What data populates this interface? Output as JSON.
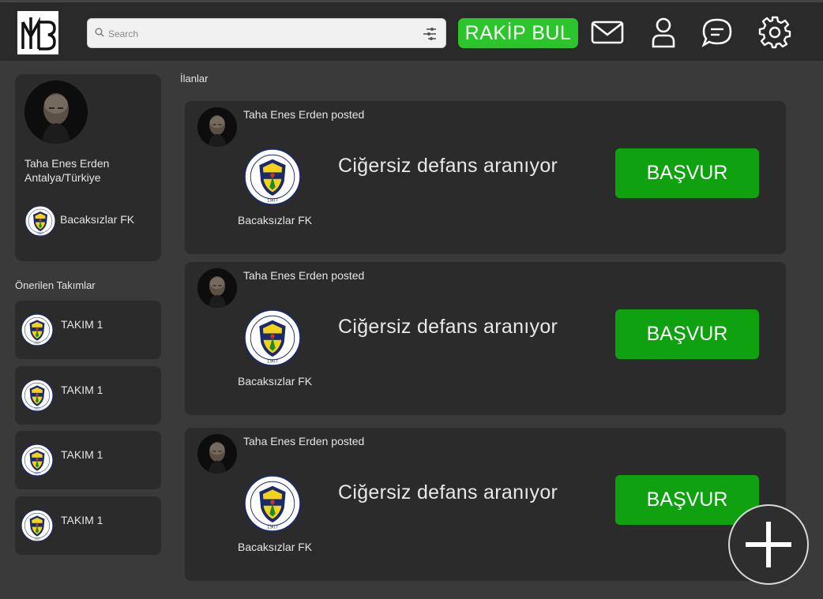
{
  "header": {
    "logo_text": "MTB",
    "search_placeholder": "Search",
    "find_opponent_label": "RAKİP BUL",
    "icons": [
      "mail-icon",
      "user-icon",
      "chat-icon",
      "gear-icon",
      "filter-icon",
      "search-icon"
    ]
  },
  "profile": {
    "name": "Taha Enes Erden",
    "location": "Antalya/Türkiye",
    "team": "Bacaksızlar FK"
  },
  "suggested": {
    "title": "Önerilen Takımlar",
    "teams": [
      {
        "name": "TAKIM 1"
      },
      {
        "name": "TAKIM 1"
      },
      {
        "name": "TAKIM 1"
      },
      {
        "name": "TAKIM 1"
      }
    ]
  },
  "feed": {
    "title": "İlanlar",
    "posts": [
      {
        "author_line": "Taha Enes Erden posted",
        "team": "Bacaksızlar FK",
        "text": "Ciğersiz defans aranıyor",
        "action": "BAŞVUR"
      },
      {
        "author_line": "Taha Enes Erden posted",
        "team": "Bacaksızlar FK",
        "text": "Ciğersiz defans aranıyor",
        "action": "BAŞVUR"
      },
      {
        "author_line": "Taha Enes Erden posted",
        "team": "Bacaksızlar FK",
        "text": "Ciğersiz defans aranıyor",
        "action": "BAŞVUR"
      }
    ]
  },
  "colors": {
    "background": "#3a3a3a",
    "topbar": "#2a2a2a",
    "card": "#2b2b2b",
    "find_button": "#2cc52c",
    "apply_button": "#0fa10f"
  }
}
